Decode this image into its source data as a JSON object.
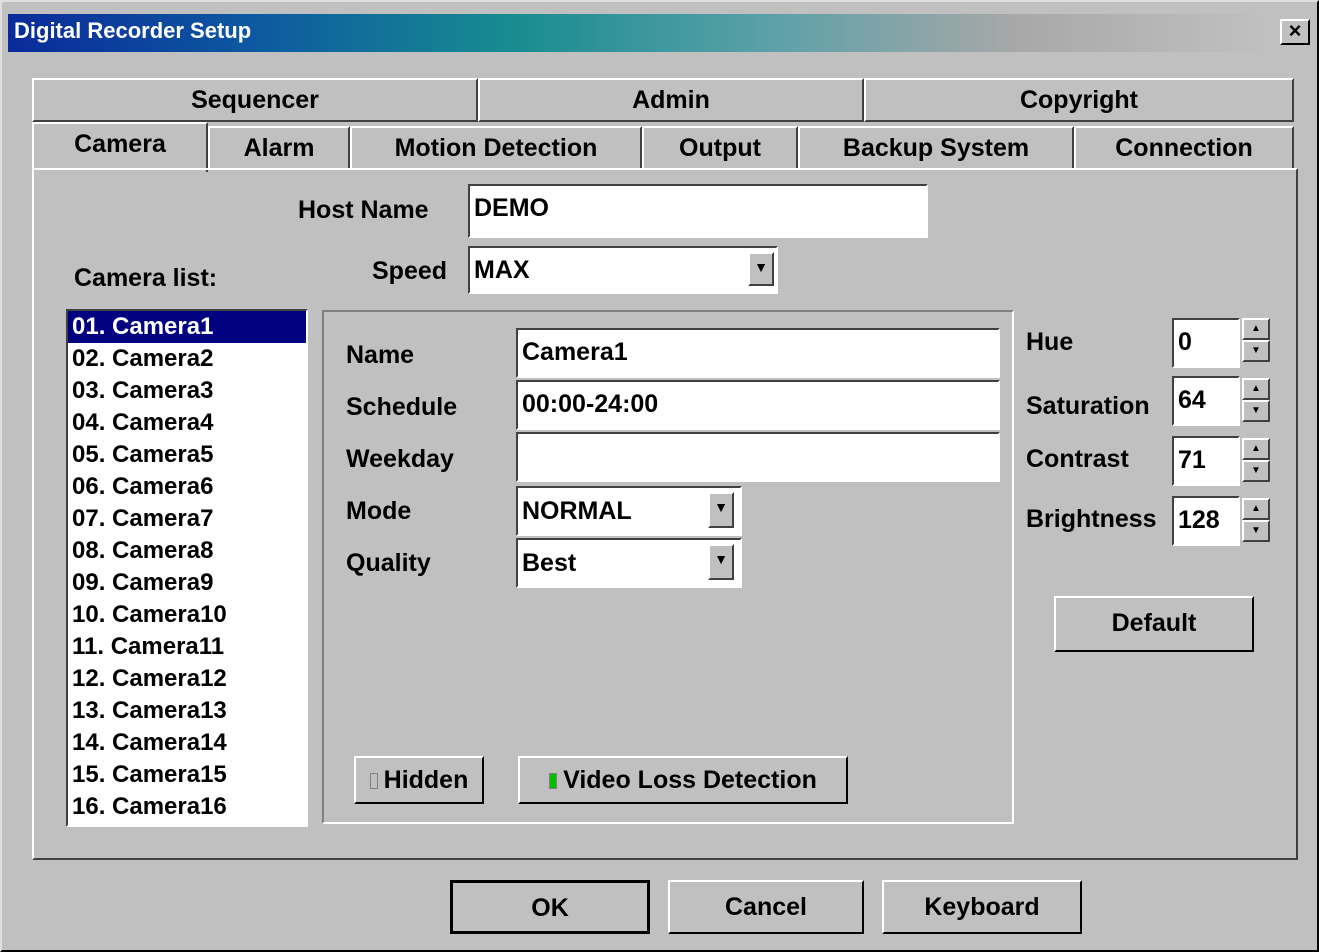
{
  "window": {
    "title": "Digital Recorder Setup",
    "close_glyph": "×"
  },
  "tabs_back": [
    "Sequencer",
    "Admin",
    "Copyright"
  ],
  "tabs_front": [
    "Camera",
    "Alarm",
    "Motion Detection",
    "Output",
    "Backup System",
    "Connection"
  ],
  "host": {
    "label": "Host Name",
    "value": "DEMO"
  },
  "speed": {
    "label": "Speed",
    "value": "MAX"
  },
  "camera_list": {
    "label": "Camera list:",
    "items": [
      "01. Camera1",
      "02. Camera2",
      "03. Camera3",
      "04. Camera4",
      "05. Camera5",
      "06. Camera6",
      "07. Camera7",
      "08. Camera8",
      "09. Camera9",
      "10. Camera10",
      "11. Camera11",
      "12. Camera12",
      "13. Camera13",
      "14. Camera14",
      "15. Camera15",
      "16. Camera16"
    ],
    "selected": "01. Camera1"
  },
  "camera": {
    "name_label": "Name",
    "name_value": "Camera1",
    "schedule_label": "Schedule",
    "schedule_value": "00:00-24:00",
    "weekday_label": "Weekday",
    "weekday_value": "",
    "mode_label": "Mode",
    "mode_value": "NORMAL",
    "quality_label": "Quality",
    "quality_value": "Best"
  },
  "toggles": {
    "hidden_label": "Hidden",
    "hidden_on": false,
    "video_loss_label": "Video Loss Detection",
    "video_loss_on": true,
    "led_on_color": "#00c000",
    "led_off_color": "#c0c0c0"
  },
  "adjust": {
    "hue_label": "Hue",
    "hue_value": "0",
    "saturation_label": "Saturation",
    "saturation_value": "64",
    "contrast_label": "Contrast",
    "contrast_value": "71",
    "brightness_label": "Brightness",
    "brightness_value": "128",
    "default_label": "Default"
  },
  "footer": {
    "ok_label": "OK",
    "cancel_label": "Cancel",
    "keyboard_label": "Keyboard"
  },
  "icons": {
    "dropdown": "chevron-down-icon",
    "spin_up": "arrow-up-icon",
    "spin_down": "arrow-down-icon"
  }
}
